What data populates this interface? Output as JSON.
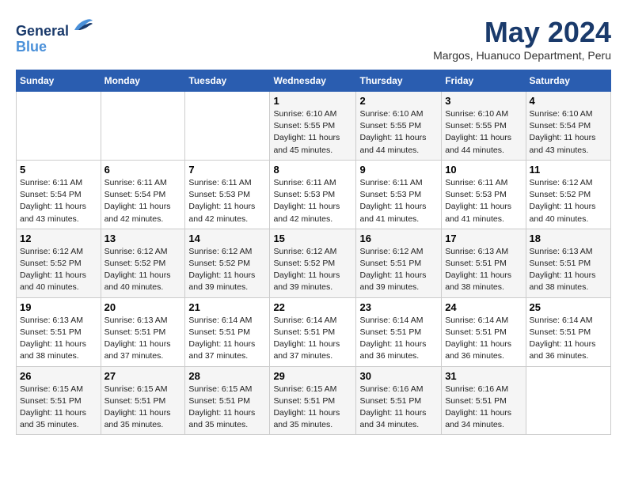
{
  "header": {
    "logo_line1": "General",
    "logo_line2": "Blue",
    "month_title": "May 2024",
    "subtitle": "Margos, Huanuco Department, Peru"
  },
  "days_of_week": [
    "Sunday",
    "Monday",
    "Tuesday",
    "Wednesday",
    "Thursday",
    "Friday",
    "Saturday"
  ],
  "weeks": [
    [
      {
        "day": "",
        "info": ""
      },
      {
        "day": "",
        "info": ""
      },
      {
        "day": "",
        "info": ""
      },
      {
        "day": "1",
        "info": "Sunrise: 6:10 AM\nSunset: 5:55 PM\nDaylight: 11 hours\nand 45 minutes."
      },
      {
        "day": "2",
        "info": "Sunrise: 6:10 AM\nSunset: 5:55 PM\nDaylight: 11 hours\nand 44 minutes."
      },
      {
        "day": "3",
        "info": "Sunrise: 6:10 AM\nSunset: 5:55 PM\nDaylight: 11 hours\nand 44 minutes."
      },
      {
        "day": "4",
        "info": "Sunrise: 6:10 AM\nSunset: 5:54 PM\nDaylight: 11 hours\nand 43 minutes."
      }
    ],
    [
      {
        "day": "5",
        "info": "Sunrise: 6:11 AM\nSunset: 5:54 PM\nDaylight: 11 hours\nand 43 minutes."
      },
      {
        "day": "6",
        "info": "Sunrise: 6:11 AM\nSunset: 5:54 PM\nDaylight: 11 hours\nand 42 minutes."
      },
      {
        "day": "7",
        "info": "Sunrise: 6:11 AM\nSunset: 5:53 PM\nDaylight: 11 hours\nand 42 minutes."
      },
      {
        "day": "8",
        "info": "Sunrise: 6:11 AM\nSunset: 5:53 PM\nDaylight: 11 hours\nand 42 minutes."
      },
      {
        "day": "9",
        "info": "Sunrise: 6:11 AM\nSunset: 5:53 PM\nDaylight: 11 hours\nand 41 minutes."
      },
      {
        "day": "10",
        "info": "Sunrise: 6:11 AM\nSunset: 5:53 PM\nDaylight: 11 hours\nand 41 minutes."
      },
      {
        "day": "11",
        "info": "Sunrise: 6:12 AM\nSunset: 5:52 PM\nDaylight: 11 hours\nand 40 minutes."
      }
    ],
    [
      {
        "day": "12",
        "info": "Sunrise: 6:12 AM\nSunset: 5:52 PM\nDaylight: 11 hours\nand 40 minutes."
      },
      {
        "day": "13",
        "info": "Sunrise: 6:12 AM\nSunset: 5:52 PM\nDaylight: 11 hours\nand 40 minutes."
      },
      {
        "day": "14",
        "info": "Sunrise: 6:12 AM\nSunset: 5:52 PM\nDaylight: 11 hours\nand 39 minutes."
      },
      {
        "day": "15",
        "info": "Sunrise: 6:12 AM\nSunset: 5:52 PM\nDaylight: 11 hours\nand 39 minutes."
      },
      {
        "day": "16",
        "info": "Sunrise: 6:12 AM\nSunset: 5:51 PM\nDaylight: 11 hours\nand 39 minutes."
      },
      {
        "day": "17",
        "info": "Sunrise: 6:13 AM\nSunset: 5:51 PM\nDaylight: 11 hours\nand 38 minutes."
      },
      {
        "day": "18",
        "info": "Sunrise: 6:13 AM\nSunset: 5:51 PM\nDaylight: 11 hours\nand 38 minutes."
      }
    ],
    [
      {
        "day": "19",
        "info": "Sunrise: 6:13 AM\nSunset: 5:51 PM\nDaylight: 11 hours\nand 38 minutes."
      },
      {
        "day": "20",
        "info": "Sunrise: 6:13 AM\nSunset: 5:51 PM\nDaylight: 11 hours\nand 37 minutes."
      },
      {
        "day": "21",
        "info": "Sunrise: 6:14 AM\nSunset: 5:51 PM\nDaylight: 11 hours\nand 37 minutes."
      },
      {
        "day": "22",
        "info": "Sunrise: 6:14 AM\nSunset: 5:51 PM\nDaylight: 11 hours\nand 37 minutes."
      },
      {
        "day": "23",
        "info": "Sunrise: 6:14 AM\nSunset: 5:51 PM\nDaylight: 11 hours\nand 36 minutes."
      },
      {
        "day": "24",
        "info": "Sunrise: 6:14 AM\nSunset: 5:51 PM\nDaylight: 11 hours\nand 36 minutes."
      },
      {
        "day": "25",
        "info": "Sunrise: 6:14 AM\nSunset: 5:51 PM\nDaylight: 11 hours\nand 36 minutes."
      }
    ],
    [
      {
        "day": "26",
        "info": "Sunrise: 6:15 AM\nSunset: 5:51 PM\nDaylight: 11 hours\nand 35 minutes."
      },
      {
        "day": "27",
        "info": "Sunrise: 6:15 AM\nSunset: 5:51 PM\nDaylight: 11 hours\nand 35 minutes."
      },
      {
        "day": "28",
        "info": "Sunrise: 6:15 AM\nSunset: 5:51 PM\nDaylight: 11 hours\nand 35 minutes."
      },
      {
        "day": "29",
        "info": "Sunrise: 6:15 AM\nSunset: 5:51 PM\nDaylight: 11 hours\nand 35 minutes."
      },
      {
        "day": "30",
        "info": "Sunrise: 6:16 AM\nSunset: 5:51 PM\nDaylight: 11 hours\nand 34 minutes."
      },
      {
        "day": "31",
        "info": "Sunrise: 6:16 AM\nSunset: 5:51 PM\nDaylight: 11 hours\nand 34 minutes."
      },
      {
        "day": "",
        "info": ""
      }
    ]
  ]
}
